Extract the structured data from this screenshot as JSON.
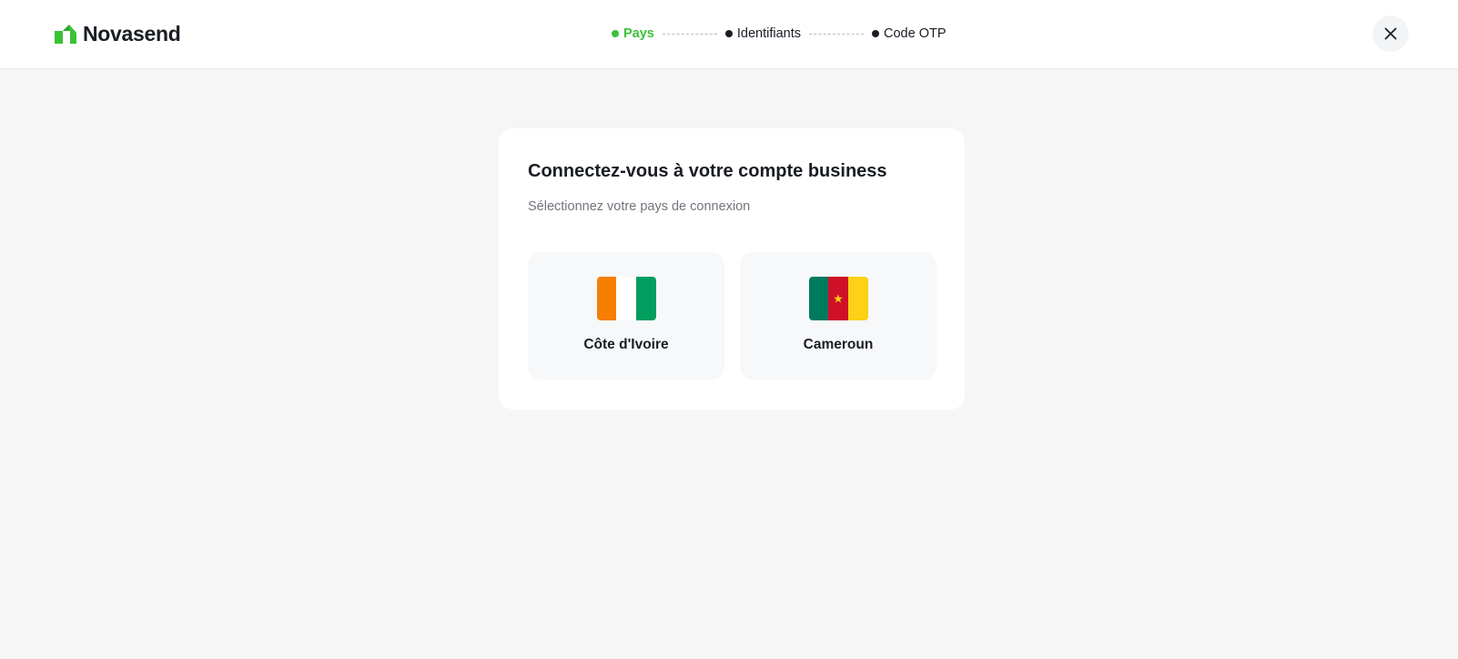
{
  "brand": {
    "name": "Novasend",
    "accent_color": "#3ac236",
    "logo_icon": "novasend-logo-icon"
  },
  "stepper": {
    "steps": [
      {
        "label": "Pays",
        "active": true
      },
      {
        "label": "Identifiants",
        "active": false
      },
      {
        "label": "Code OTP",
        "active": false
      }
    ]
  },
  "close_icon": "close-icon",
  "card": {
    "title": "Connectez-vous à votre compte business",
    "subtitle": "Sélectionnez votre pays de connexion",
    "countries": [
      {
        "name": "Côte d'Ivoire",
        "flag_icon": "cote-divoire-flag-icon",
        "flag_colors": [
          "#f77f00",
          "#ffffff",
          "#009e60"
        ]
      },
      {
        "name": "Cameroun",
        "flag_icon": "cameroon-flag-icon",
        "flag_colors": [
          "#007a5e",
          "#ce1126",
          "#fcd116"
        ]
      }
    ]
  }
}
